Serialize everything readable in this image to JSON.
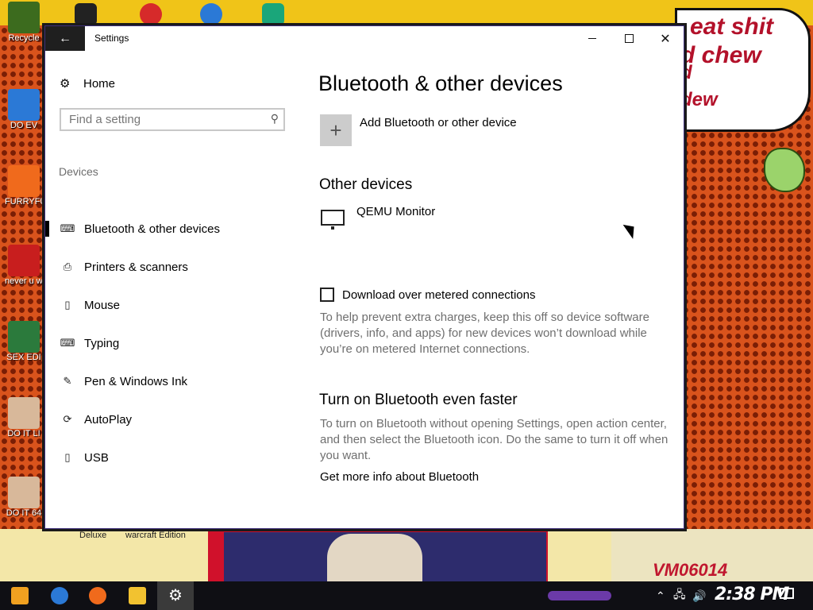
{
  "desktop": {
    "icons": [
      {
        "label": "Recycle",
        "color": "#3c6b1e"
      },
      {
        "label": "DO EV",
        "color": "#2b79d6"
      },
      {
        "label": "FURRYFU",
        "color": "#f06a1c"
      },
      {
        "label": "never u why is it",
        "color": "#c81e1e"
      },
      {
        "label": "SEX EDI",
        "color": "#2b7a3c"
      },
      {
        "label": "DO IT LI",
        "color": "#d8b89a"
      },
      {
        "label": "DO IT 64",
        "color": "#d8b89a"
      }
    ],
    "speech_lines": [
      "eat shit",
      "d chew",
      "d",
      "dew"
    ],
    "bottom_labels": [
      "Deluxe",
      "warcraft Edition"
    ],
    "corner_tag": "VM06014"
  },
  "window": {
    "title": "Settings",
    "back_icon": "back-arrow-icon",
    "controls": {
      "minimize": "minimize-icon",
      "maximize": "maximize-icon",
      "close": "close-icon"
    }
  },
  "sidebar": {
    "home_label": "Home",
    "search_placeholder": "Find a setting",
    "group_label": "Devices",
    "items": [
      {
        "label": "Bluetooth & other devices",
        "icon": "bluetooth-devices-icon",
        "glyph": "⌨",
        "active": true
      },
      {
        "label": "Printers & scanners",
        "icon": "printer-icon",
        "glyph": "⎙",
        "active": false
      },
      {
        "label": "Mouse",
        "icon": "mouse-icon",
        "glyph": "▯",
        "active": false
      },
      {
        "label": "Typing",
        "icon": "keyboard-icon",
        "glyph": "⌨",
        "active": false
      },
      {
        "label": "Pen & Windows Ink",
        "icon": "pen-icon",
        "glyph": "✎",
        "active": false
      },
      {
        "label": "AutoPlay",
        "icon": "autoplay-icon",
        "glyph": "⟳",
        "active": false
      },
      {
        "label": "USB",
        "icon": "usb-icon",
        "glyph": "▯",
        "active": false
      }
    ]
  },
  "main": {
    "title": "Bluetooth & other devices",
    "add_device_label": "Add Bluetooth or other device",
    "other_devices_heading": "Other devices",
    "device_name": "QEMU Monitor",
    "metered_checkbox_label": "Download over metered connections",
    "metered_checked": false,
    "metered_description": "To help prevent extra charges, keep this off so device software (drivers, info, and apps) for new devices won’t download while you’re on metered Internet connections.",
    "faster_heading": "Turn on Bluetooth even faster",
    "faster_description": "To turn on Bluetooth without opening Settings, open action center, and then select the Bluetooth icon. Do the same to turn it off when you want.",
    "more_info_link": "Get more info about Bluetooth"
  },
  "taskbar": {
    "apps": [
      {
        "name": "start",
        "icon": "start-icon",
        "color": "#f0a020"
      },
      {
        "name": "chrome",
        "icon": "chrome-icon",
        "color": "#2b79d6"
      },
      {
        "name": "firefox",
        "icon": "firefox-icon",
        "color": "#f06a1c"
      },
      {
        "name": "file-explorer",
        "icon": "folder-icon",
        "color": "#f2c230"
      },
      {
        "name": "settings",
        "icon": "gear-icon",
        "color": "#ffffff",
        "active": true
      }
    ],
    "clock": "2:38 PM",
    "tray_icons": [
      "chevron-up-icon",
      "network-icon",
      "volume-icon",
      "notification-icon"
    ]
  }
}
